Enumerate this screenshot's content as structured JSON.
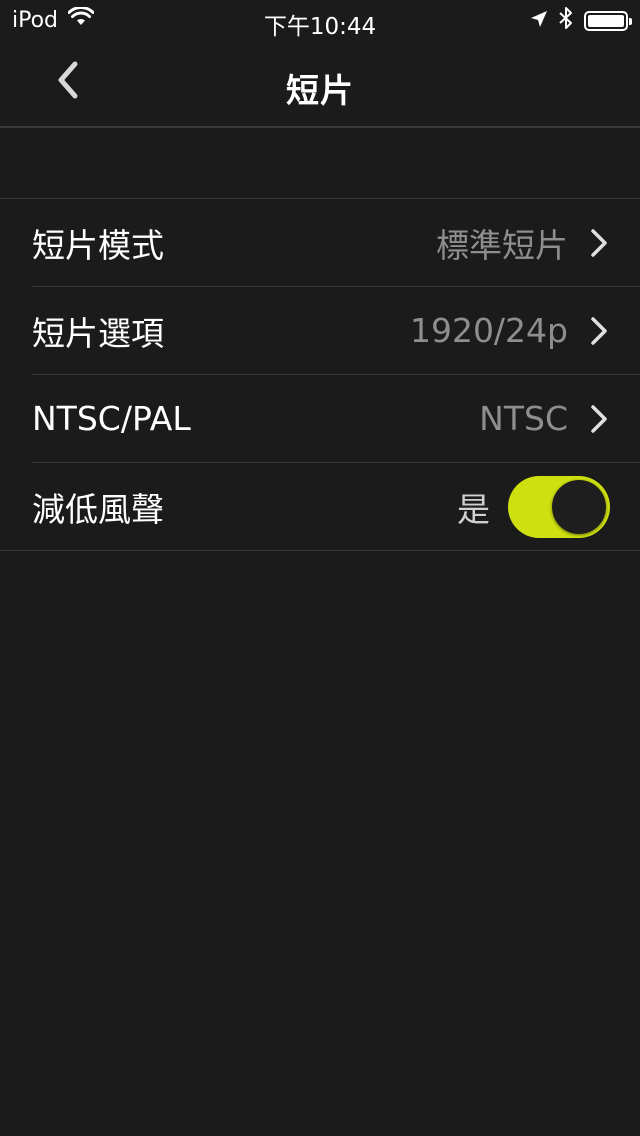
{
  "status_bar": {
    "device": "iPod",
    "time": "下午10:44",
    "icons": [
      "wifi-icon",
      "location-arrow-icon",
      "bluetooth-icon",
      "battery-icon"
    ]
  },
  "nav": {
    "title": "短片",
    "back_icon": "chevron-left-icon"
  },
  "settings": [
    {
      "label": "短片模式",
      "value": "標準短片",
      "type": "disclosure"
    },
    {
      "label": "短片選項",
      "value": "1920/24p",
      "type": "disclosure"
    },
    {
      "label": "NTSC/PAL",
      "value": "NTSC",
      "type": "disclosure"
    },
    {
      "label": "減低風聲",
      "value": "是",
      "type": "toggle",
      "on": true
    }
  ],
  "colors": {
    "background": "#1b1b1b",
    "accent": "#cfe011",
    "secondary_text": "#8e8e8e"
  }
}
